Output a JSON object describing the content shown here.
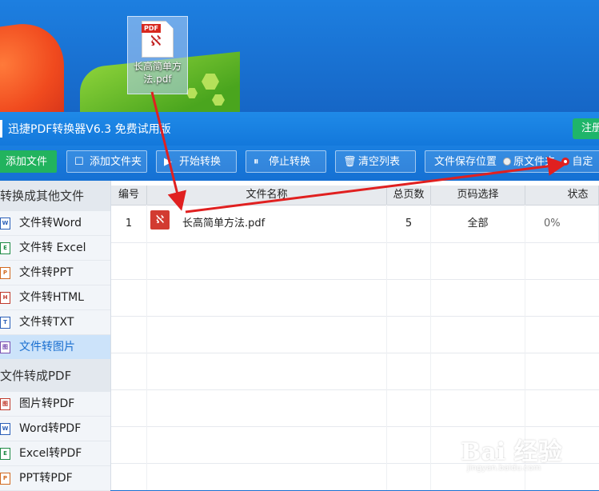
{
  "desktop": {
    "file_icon": {
      "tag": "PDF",
      "label_line1": "长高简单方",
      "label_line2": "法.pdf"
    }
  },
  "window": {
    "title": "迅捷PDF转换器V6.3 免费试用版",
    "register_label": "注册"
  },
  "toolbar": {
    "add_file": "添加文件",
    "add_folder": "添加文件夹",
    "start_convert": "开始转换",
    "stop_convert": "停止转换",
    "clear_list": "清空列表",
    "save_location": "文件保存位置",
    "radio_original": "原文件夹",
    "radio_custom": "自定"
  },
  "sidebar": {
    "section1": "转换成其他文件",
    "section1_items": [
      {
        "label": "文件转Word",
        "icon": "W"
      },
      {
        "label": "文件转 Excel",
        "icon": "E"
      },
      {
        "label": "文件转PPT",
        "icon": "P"
      },
      {
        "label": "文件转HTML",
        "icon": "H"
      },
      {
        "label": "文件转TXT",
        "icon": "T"
      },
      {
        "label": "文件转图片",
        "icon": "图"
      }
    ],
    "section2": "文件转成PDF",
    "section2_items": [
      {
        "label": "图片转PDF",
        "icon": "图"
      },
      {
        "label": "Word转PDF",
        "icon": "W"
      },
      {
        "label": "Excel转PDF",
        "icon": "E"
      },
      {
        "label": "PPT转PDF",
        "icon": "P"
      }
    ]
  },
  "table": {
    "headers": [
      "编号",
      "文件名称",
      "总页数",
      "页码选择",
      "状态"
    ],
    "rows": [
      {
        "index": "1",
        "name": "长高简单方法.pdf",
        "pages": "5",
        "range": "全部",
        "status": "0%"
      }
    ]
  },
  "watermark": {
    "main": "Bai 经验",
    "sub": "jingyan.baidu.com"
  },
  "colors": {
    "accent": "#1a7fe0",
    "green": "#22b35e",
    "arrow": "#e02020"
  }
}
